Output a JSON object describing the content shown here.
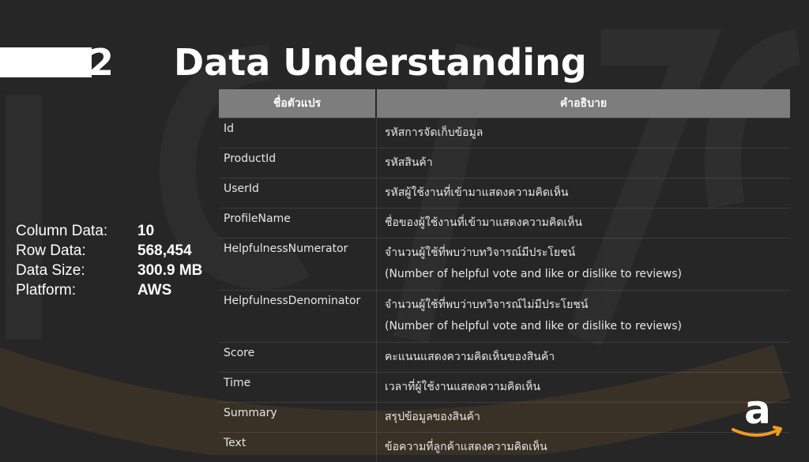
{
  "section": {
    "number": "2",
    "title": "Data Understanding"
  },
  "stats": [
    {
      "label": "Column Data:",
      "value": "10"
    },
    {
      "label": "Row Data:",
      "value": "568,454"
    },
    {
      "label": "Data Size:",
      "value": "300.9 MB"
    },
    {
      "label": "Platform:",
      "value": "AWS"
    }
  ],
  "table": {
    "headers": [
      "ชื่อตัวแปร",
      "คำอธิบาย"
    ],
    "rows": [
      {
        "name": "Id",
        "desc": "รหัสการจัดเก็บข้อมูล"
      },
      {
        "name": "ProductId",
        "desc": "รหัสสินค้า"
      },
      {
        "name": "UserId",
        "desc": "รหัสผู้ใช้งานที่เข้ามาแสดงความคิดเห็น"
      },
      {
        "name": "ProfileName",
        "desc": "ชื่อของผู้ใช้งานที่เข้ามาแสดงความคิดเห็น"
      },
      {
        "name": "HelpfulnessNumerator",
        "desc": "จำนวนผู้ใช้ที่พบว่าบทวิจารณ์มีประโยชน์",
        "note": "(Number of helpful vote and like or dislike to reviews)"
      },
      {
        "name": "HelpfulnessDenominator",
        "desc": "จำนวนผู้ใช้ที่พบว่าบทวิจารณ์ไม่มีประโยชน์",
        "note": "(Number of helpful vote and like or dislike to reviews)"
      },
      {
        "name": "Score",
        "desc": "คะแนนแสดงความคิดเห็นของสินค้า"
      },
      {
        "name": "Time",
        "desc": "เวลาที่ผู้ใช้งานแสดงความคิดเห็น"
      },
      {
        "name": "Summary",
        "desc": "สรุปข้อมูลของสินค้า"
      },
      {
        "name": "Text",
        "desc": "ข้อความที่ลูกค้าแสดงความคิดเห็น"
      }
    ]
  },
  "logo": {
    "glyph": "a",
    "icon": "amazon-logo-icon",
    "color": "#f29b1f"
  }
}
